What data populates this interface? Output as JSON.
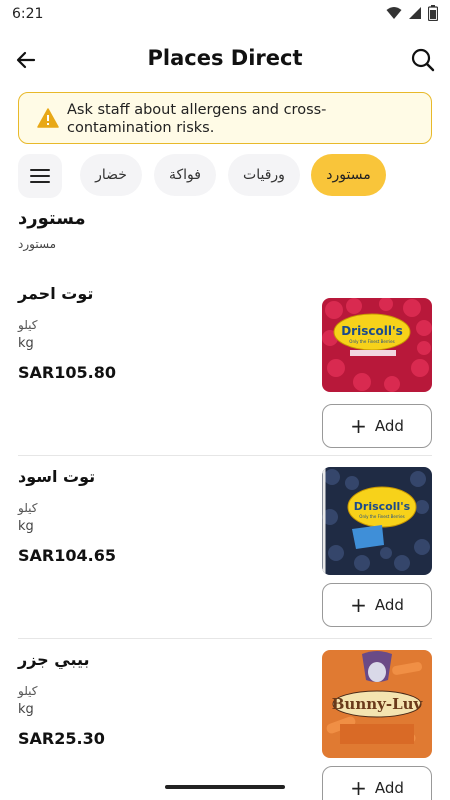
{
  "status_bar": {
    "time": "6:21"
  },
  "app_bar": {
    "title": "Places Direct"
  },
  "allergen_notice": {
    "text": "Ask staff about allergens and cross-contamination risks."
  },
  "categories": [
    {
      "label": "مستورد",
      "active": true
    },
    {
      "label": "ورقيات",
      "active": false
    },
    {
      "label": "فواكة",
      "active": false
    },
    {
      "label": "خضار",
      "active": false
    }
  ],
  "section": {
    "title": "مستورد",
    "subtitle": "مستورد"
  },
  "products": [
    {
      "name": "توت احمر",
      "unit_ar": "كيلو",
      "unit_en": "kg",
      "price": "SAR105.80",
      "add_label": "Add",
      "image_icon": "raspberries-image"
    },
    {
      "name": "توت اسود",
      "unit_ar": "كيلو",
      "unit_en": "kg",
      "price": "SAR104.65",
      "add_label": "Add",
      "image_icon": "blueberries-image"
    },
    {
      "name": "بيبي جزر",
      "unit_ar": "كيلو",
      "unit_en": "kg",
      "price": "SAR25.30",
      "add_label": "Add",
      "image_icon": "baby-carrots-image"
    }
  ],
  "colors": {
    "accent": "#f9c53a",
    "warning_border": "#e8b92a",
    "warning_bg": "#fffbe6"
  }
}
